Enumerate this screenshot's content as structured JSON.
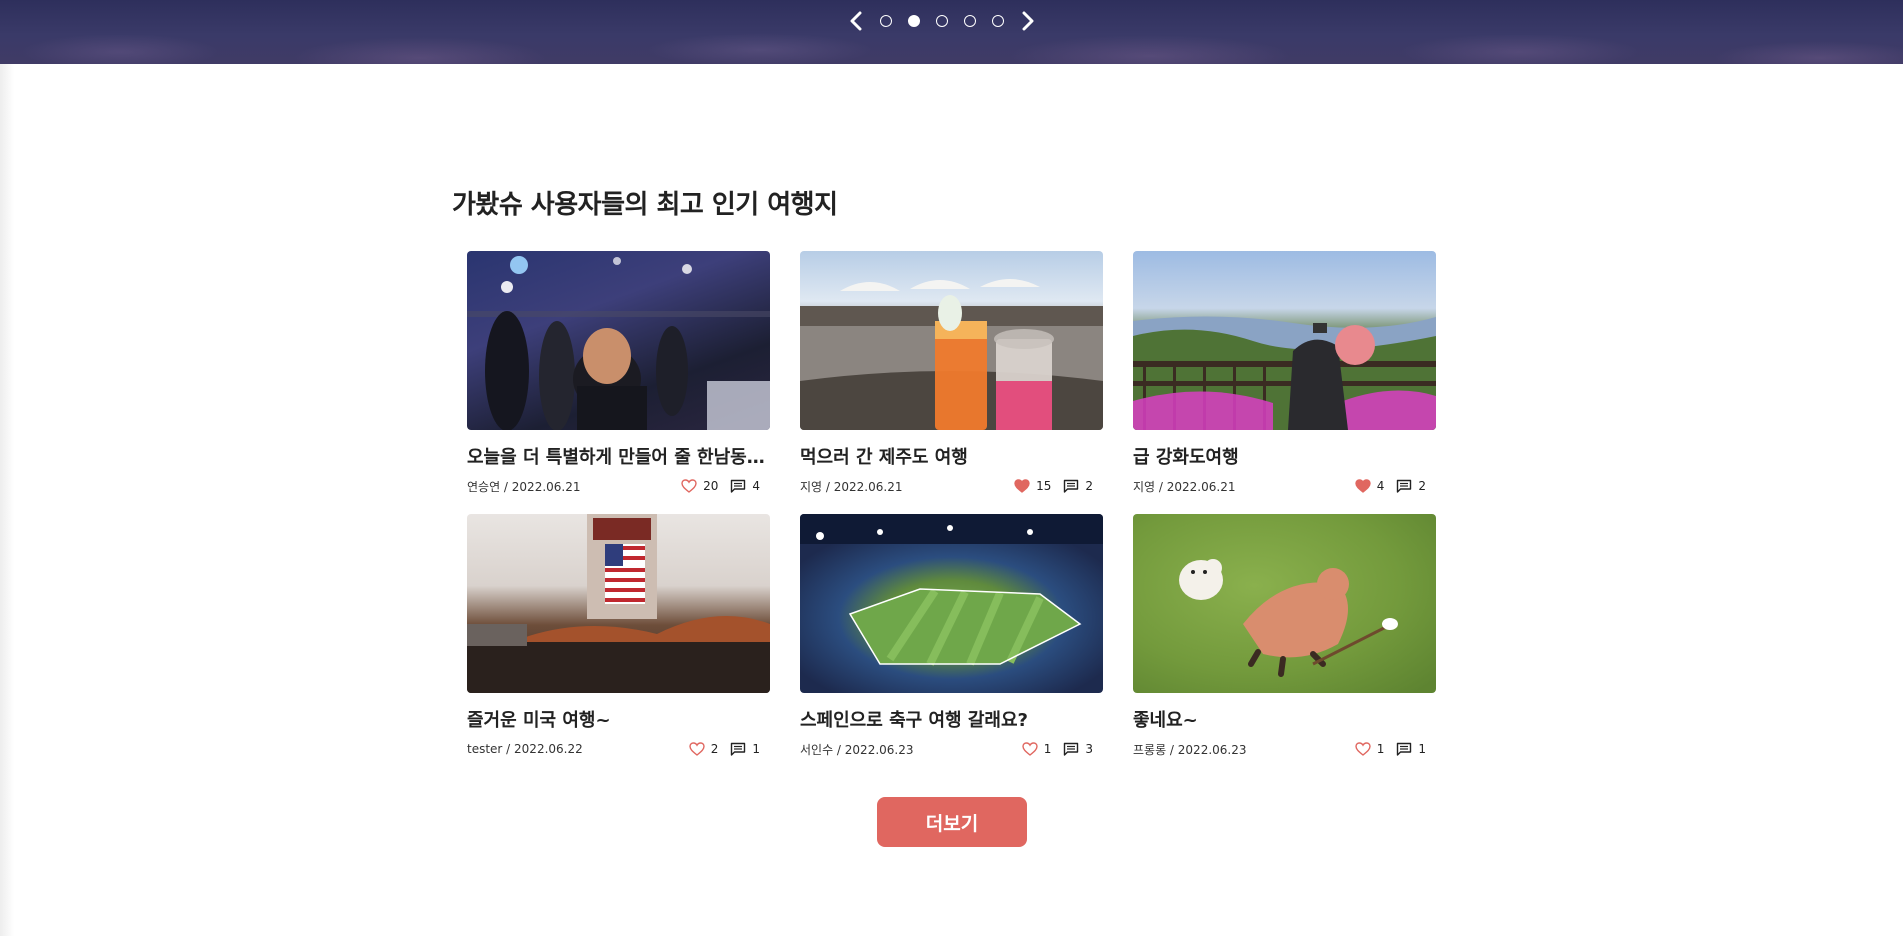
{
  "carousel": {
    "prev_icon": "chevron-left-icon",
    "next_icon": "chevron-right-icon",
    "slide_count": 5,
    "active_index": 1
  },
  "section": {
    "title": "가봤슈 사용자들의 최고 인기 여행지"
  },
  "posts": [
    {
      "title": "오늘을 더 특별하게 만들어 줄 한남동 ...",
      "author": "연승연",
      "date": "2022.06.21",
      "author_date": "연승연 / 2022.06.21",
      "likes": "20",
      "liked": false,
      "comments": "4"
    },
    {
      "title": "먹으러 간 제주도 여행",
      "author": "지영",
      "date": "2022.06.21",
      "author_date": "지영 / 2022.06.21",
      "likes": "15",
      "liked": true,
      "comments": "2"
    },
    {
      "title": "급 강화도여행",
      "author": "지영",
      "date": "2022.06.21",
      "author_date": "지영 / 2022.06.21",
      "likes": "4",
      "liked": true,
      "comments": "2"
    },
    {
      "title": "즐거운 미국 여행~",
      "author": "tester",
      "date": "2022.06.22",
      "author_date": "tester / 2022.06.22",
      "likes": "2",
      "liked": false,
      "comments": "1"
    },
    {
      "title": "스페인으로 축구 여행 갈래요?",
      "author": "서인수",
      "date": "2022.06.23",
      "author_date": "서인수 / 2022.06.23",
      "likes": "1",
      "liked": false,
      "comments": "3"
    },
    {
      "title": "좋네요~",
      "author": "프롱롱",
      "date": "2022.06.23",
      "author_date": "프롱롱 / 2022.06.23",
      "likes": "1",
      "liked": false,
      "comments": "1"
    }
  ],
  "more_button": {
    "label": "더보기"
  },
  "colors": {
    "accent": "#e06760",
    "heart": "#e06760",
    "text": "#222222"
  }
}
